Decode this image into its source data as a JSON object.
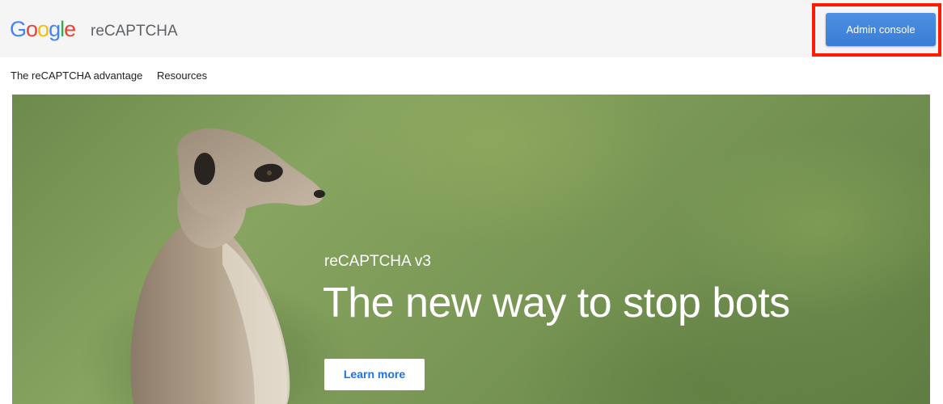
{
  "header": {
    "logo_letters": [
      "G",
      "o",
      "o",
      "g",
      "l",
      "e"
    ],
    "logo_colors": [
      "#4285F4",
      "#EA4335",
      "#FBBC05",
      "#4285F4",
      "#34A853",
      "#EA4335"
    ],
    "product_name": "reCAPTCHA",
    "admin_button_label": "Admin console",
    "highlight_color": "#ff1a00",
    "button_color": "#3a7dd6"
  },
  "nav": {
    "items": [
      {
        "label": "The reCAPTCHA advantage"
      },
      {
        "label": "Resources"
      }
    ]
  },
  "hero": {
    "image": "meerkat-photo",
    "subtitle": "reCAPTCHA v3",
    "title": "The new way to stop bots",
    "button_label": "Learn more",
    "button_text_color": "#1a73e8"
  }
}
